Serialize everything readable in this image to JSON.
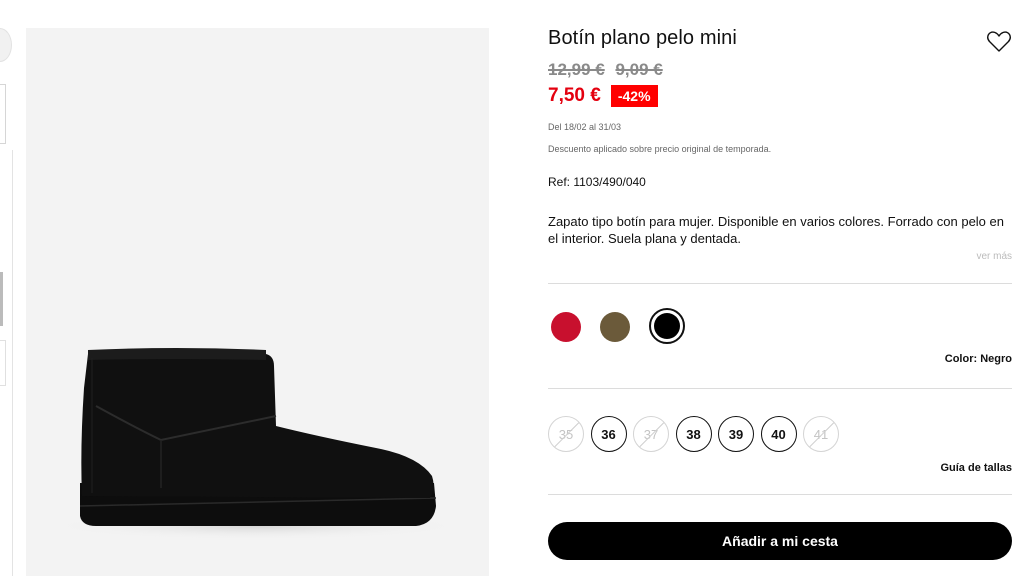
{
  "product": {
    "title": "Botín plano pelo mini",
    "old_prices": [
      "12,99 €",
      "9,09 €"
    ],
    "price": "7,50 €",
    "discount": "-42%",
    "period": "Del 18/02 al 31/03",
    "discount_note": "Descuento aplicado sobre precio original de temporada.",
    "ref": "Ref: 1103/490/040",
    "description": "Zapato tipo botín para mujer. Disponible en varios colores. Forrado con pelo en el interior. Suela plana y dentada.",
    "more_label": "ver más",
    "favorite_icon": "heart-outline-icon"
  },
  "colors": {
    "swatches": [
      {
        "name": "red",
        "hex": "#c8102e"
      },
      {
        "name": "brown",
        "hex": "#6b5a3a"
      },
      {
        "name": "black",
        "hex": "#000000",
        "selected": true
      }
    ],
    "label": "Color: Negro"
  },
  "sizes": {
    "items": [
      {
        "label": "35",
        "available": false
      },
      {
        "label": "36",
        "available": true
      },
      {
        "label": "37",
        "available": false
      },
      {
        "label": "38",
        "available": true
      },
      {
        "label": "39",
        "available": true
      },
      {
        "label": "40",
        "available": true
      },
      {
        "label": "41",
        "available": false
      }
    ],
    "guide_label": "Guía de tallas"
  },
  "cart": {
    "add_label": "Añadir a mi cesta"
  }
}
